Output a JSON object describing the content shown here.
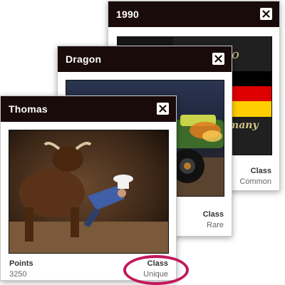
{
  "cards": [
    {
      "title": "1990",
      "field_label": "Class",
      "field_value": "Common"
    },
    {
      "title": "Dragon",
      "field_label": "Class",
      "field_value": "Rare"
    },
    {
      "title": "Thomas",
      "points_label": "Points",
      "points_value": "3250",
      "field_label": "Class",
      "field_value": "Unique"
    }
  ],
  "photo_1990": {
    "text_top": "o",
    "text_bottom": "rmany"
  },
  "colors": {
    "header_bg": "#1a0b0b",
    "highlight": "#c2185b",
    "flag_black": "#000000",
    "flag_red": "#dd0000",
    "flag_gold": "#ffce00"
  },
  "icons": {
    "close": "close-icon"
  }
}
